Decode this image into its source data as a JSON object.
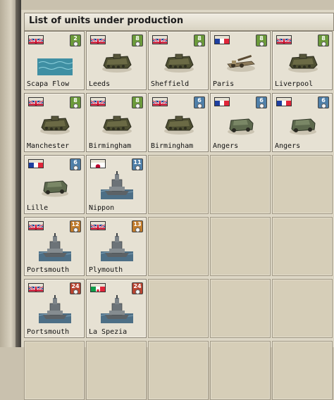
{
  "panel": {
    "title": "List of units under production"
  },
  "colors": {
    "uk_blue": "#1f3d8c",
    "uk_red": "#c8102e",
    "fr_blue": "#1e3fa0",
    "fr_red": "#e0263a",
    "jp_red": "#bc002d",
    "it_green": "#119b49",
    "badge_green": "#6b9a3a",
    "badge_blue": "#4f7fa8",
    "badge_orange": "#c07a2a",
    "badge_red": "#b8432f"
  },
  "units": [
    {
      "city": "Scapa Flow",
      "flag": "uk",
      "badge": "2",
      "badge_color": "green",
      "unit": "sea"
    },
    {
      "city": "Leeds",
      "flag": "uk",
      "badge": "8",
      "badge_color": "green",
      "unit": "tank"
    },
    {
      "city": "Sheffield",
      "flag": "uk",
      "badge": "8",
      "badge_color": "green",
      "unit": "tank"
    },
    {
      "city": "Paris",
      "flag": "fr",
      "badge": "8",
      "badge_color": "green",
      "unit": "artillery"
    },
    {
      "city": "Liverpool",
      "flag": "uk",
      "badge": "8",
      "badge_color": "green",
      "unit": "tank"
    },
    {
      "city": "Manchester",
      "flag": "uk",
      "badge": "8",
      "badge_color": "green",
      "unit": "tank"
    },
    {
      "city": "Birmingham",
      "flag": "uk",
      "badge": "8",
      "badge_color": "green",
      "unit": "tank"
    },
    {
      "city": "Birmingham",
      "flag": "uk",
      "badge": "6",
      "badge_color": "blue",
      "unit": "tank"
    },
    {
      "city": "Angers",
      "flag": "fr",
      "badge": "6",
      "badge_color": "blue",
      "unit": "armored"
    },
    {
      "city": "Angers",
      "flag": "fr",
      "badge": "6",
      "badge_color": "blue",
      "unit": "armored"
    },
    {
      "city": "Lille",
      "flag": "fr",
      "badge": "6",
      "badge_color": "blue",
      "unit": "armored"
    },
    {
      "city": "Nippon",
      "flag": "jp",
      "badge": "11",
      "badge_color": "blue",
      "unit": "ship"
    },
    {
      "city": "Portsmouth",
      "flag": "uk",
      "badge": "12",
      "badge_color": "orange",
      "unit": "ship"
    },
    {
      "city": "Plymouth",
      "flag": "uk",
      "badge": "13",
      "badge_color": "orange",
      "unit": "ship"
    },
    {
      "city": "Portsmouth",
      "flag": "uk",
      "badge": "24",
      "badge_color": "red",
      "unit": "ship"
    },
    {
      "city": "La Spezia",
      "flag": "it",
      "badge": "24",
      "badge_color": "red",
      "unit": "ship"
    }
  ]
}
